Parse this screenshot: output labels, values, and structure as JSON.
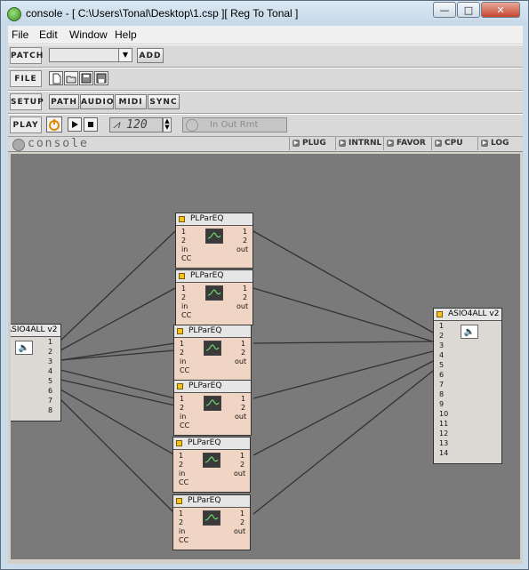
{
  "window": {
    "title": "console - [ C:\\Users\\Tonal\\Desktop\\1.csp ][ Reg To Tonal ]",
    "minimize": "—",
    "maximize": "□",
    "close": "✕"
  },
  "menu": {
    "file": "File",
    "edit": "Edit",
    "window": "Window",
    "help": "Help"
  },
  "toolbar": {
    "patch_label": "PATCH",
    "patch_select_value": "",
    "add_label": "ADD",
    "file_label": "FILE",
    "setup_label": "SETUP",
    "setup_buttons": [
      "PATH",
      "AUDIO",
      "MIDI",
      "SYNC"
    ],
    "play_label": "PLAY",
    "tempo": "120",
    "clock_text": "In  Out  Rmt"
  },
  "consolebar": {
    "brand": "console",
    "nav": [
      "PLUG",
      "INTRNL",
      "FAVOR",
      "CPU",
      "LOG"
    ]
  },
  "modules": {
    "eq_name": "PLParEQ",
    "eq_inputs": [
      "1",
      "2",
      "in",
      "CC"
    ],
    "eq_outputs": [
      "1",
      "2",
      "out"
    ],
    "asio_name": "ASIO4ALL v2",
    "asio_left_name": "ASIO4ALL v2",
    "asio_left_pins": [
      "1",
      "2",
      "3",
      "4",
      "5",
      "6",
      "7",
      "8"
    ],
    "asio_right_pins": [
      "1",
      "2",
      "3",
      "4",
      "5",
      "6",
      "7",
      "8",
      "9",
      "10",
      "11",
      "12",
      "13",
      "14"
    ]
  },
  "colors": {
    "canvas": "#7a7a7a",
    "module_body": "#f0d4c4",
    "led": "#f4c21e"
  },
  "icons": [
    "app-icon",
    "new-file-icon",
    "open-file-icon",
    "save-icon",
    "save-as-icon",
    "power-icon",
    "play-icon",
    "stop-icon",
    "metronome-icon",
    "clock-icon",
    "speaker-icon",
    "eq-curve-icon"
  ]
}
